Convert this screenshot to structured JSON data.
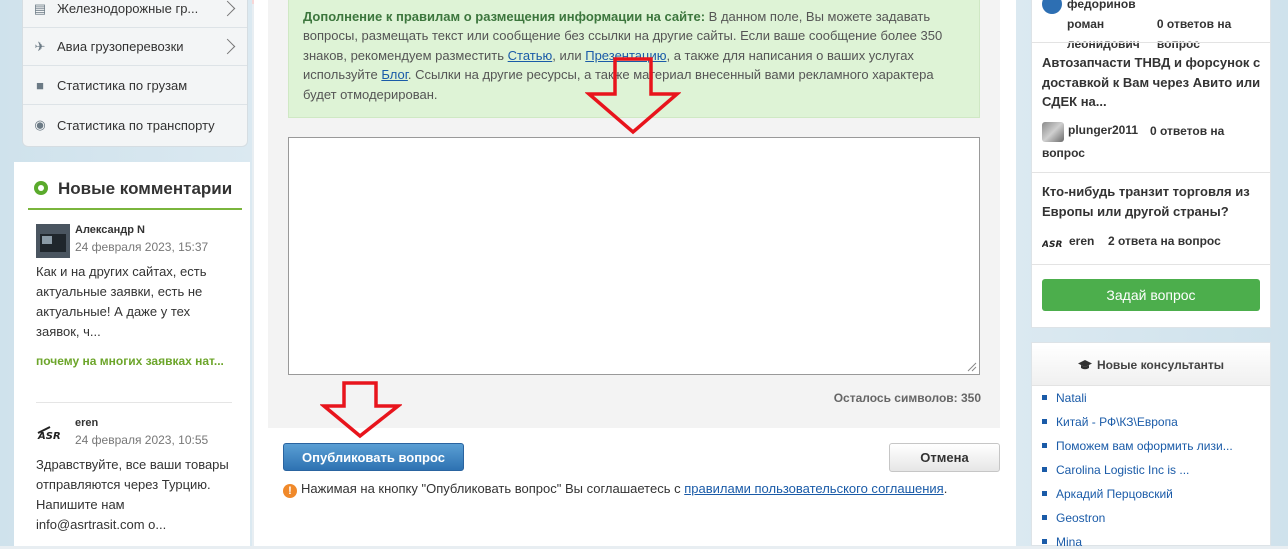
{
  "left_menu": {
    "items": [
      {
        "label": "Железнодорожные гр...",
        "icon": "train-icon"
      },
      {
        "label": "Авиа грузоперевозки",
        "icon": "plane-icon"
      },
      {
        "label": "Статистика по грузам",
        "icon": "box-icon"
      },
      {
        "label": "Статистика по транспорту",
        "icon": "transport-icon"
      }
    ]
  },
  "comments": {
    "title": "Новые комментарии",
    "items": [
      {
        "author": "Александр N",
        "date": "24 февраля 2023, 15:37",
        "text": "Как и на других сайтах, есть актуальные заявки, есть не актуальные! А даже у тех заявок, ч...",
        "link": "почему на многих заявках нат..."
      },
      {
        "author": "eren",
        "date": "24 февраля 2023, 10:55",
        "text": "Здравствуйте, все ваши товары отправляются через Турцию. Напишите нам info@asrtrasit.com о..."
      }
    ]
  },
  "notice": {
    "bold": "Дополнение к правилам о размещения информации на сайте:",
    "t1": " В данном поле, Вы можете задавать вопросы, размещать текст или сообщение без ссылки на другие сайты. Если ваше сообщение более 350 знаков, рекомендуем разместить ",
    "link1": "Статью",
    "t2": ", или ",
    "link2": "Презентацию",
    "t3": ", а также для написания о ваших услугах используйте ",
    "link3": "Блог",
    "t4": ". Ссылки на другие ресурсы, а также материал внесенный вами рекламного характера будет отмодерирован."
  },
  "form": {
    "remaining": "Осталось символов: 350",
    "publish_label": "Опубликовать вопрос",
    "cancel_label": "Отмена",
    "agree_text": "Нажимая на кнопку \"Опубликовать вопрос\" Вы соглашаетесь с ",
    "agree_link": "правилами пользовательского соглашения",
    "agree_end": "."
  },
  "questions": [
    {
      "title": "",
      "author": "федоринов роман леонидович",
      "answers": "0 ответов на вопрос"
    },
    {
      "title": "Автозапчасти ТНВД и форсунок с доставкой к Вам через Авито или СДЕК на...",
      "author": "plunger2011",
      "answers": "0 ответов на вопрос"
    },
    {
      "title": "Кто-нибудь транзит торговля из Европы или другой страны?",
      "author": "eren",
      "answers": "2 ответа на вопрос"
    }
  ],
  "ask_button": "Задай вопрос",
  "consultants": {
    "title": "Новые консультанты",
    "items": [
      "Natali",
      "Китай - РФ\\КЗ\\Европа",
      "Поможем вам оформить лизи...",
      "Carolina Logistic Inc is ...",
      "Аркадий Перцовский",
      "Geostron",
      "Mina"
    ]
  },
  "colors": {
    "accent_green": "#4cae4c",
    "link_blue": "#1a5ba8",
    "annotation_red": "#e8141c"
  }
}
